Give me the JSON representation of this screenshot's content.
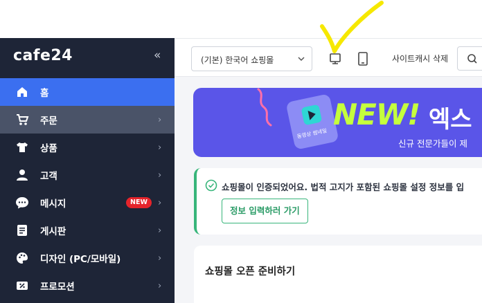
{
  "sidebar": {
    "logo": "cafe24",
    "collapse_symbol": "«",
    "items": [
      {
        "label": "홈",
        "icon": "home-icon",
        "state": "active",
        "has_chevron": false
      },
      {
        "label": "주문",
        "icon": "cart-icon",
        "state": "hover",
        "has_chevron": true
      },
      {
        "label": "상품",
        "icon": "tshirt-icon",
        "state": "",
        "has_chevron": true
      },
      {
        "label": "고객",
        "icon": "person-icon",
        "state": "",
        "has_chevron": true
      },
      {
        "label": "메시지",
        "icon": "chat-icon",
        "state": "",
        "has_chevron": true,
        "badge": "NEW"
      },
      {
        "label": "게시판",
        "icon": "board-icon",
        "state": "",
        "has_chevron": true
      },
      {
        "label": "디자인 (PC/모바일)",
        "icon": "palette-icon",
        "state": "",
        "has_chevron": true
      },
      {
        "label": "프로모션",
        "icon": "coupon-icon",
        "state": "",
        "has_chevron": true
      }
    ],
    "chevron_symbol": "›"
  },
  "topbar": {
    "shop_select_value": "(기본) 한국어 쇼핑몰",
    "cache_button": "사이트캐시 삭제"
  },
  "banner": {
    "headline": "NEW!",
    "headline_word": "엑스",
    "subtitle": "신규 전문가들이 제",
    "card_label": "동영상 썸네일"
  },
  "notice": {
    "message": "쇼핑몰이 인증되었어요. 법적 고지가 포함된 쇼핑몰 설정 정보를 입",
    "button": "정보 입력하러 가기"
  },
  "prep": {
    "title": "쇼핑몰 오픈 준비하기"
  },
  "colors": {
    "sidebar_bg": "#1e2537",
    "active_blue": "#3b6ff0",
    "banner_purple": "#5a55e8",
    "banner_lime": "#c5ff3d",
    "success_green": "#37b57a",
    "new_badge_red": "#e5242b"
  }
}
